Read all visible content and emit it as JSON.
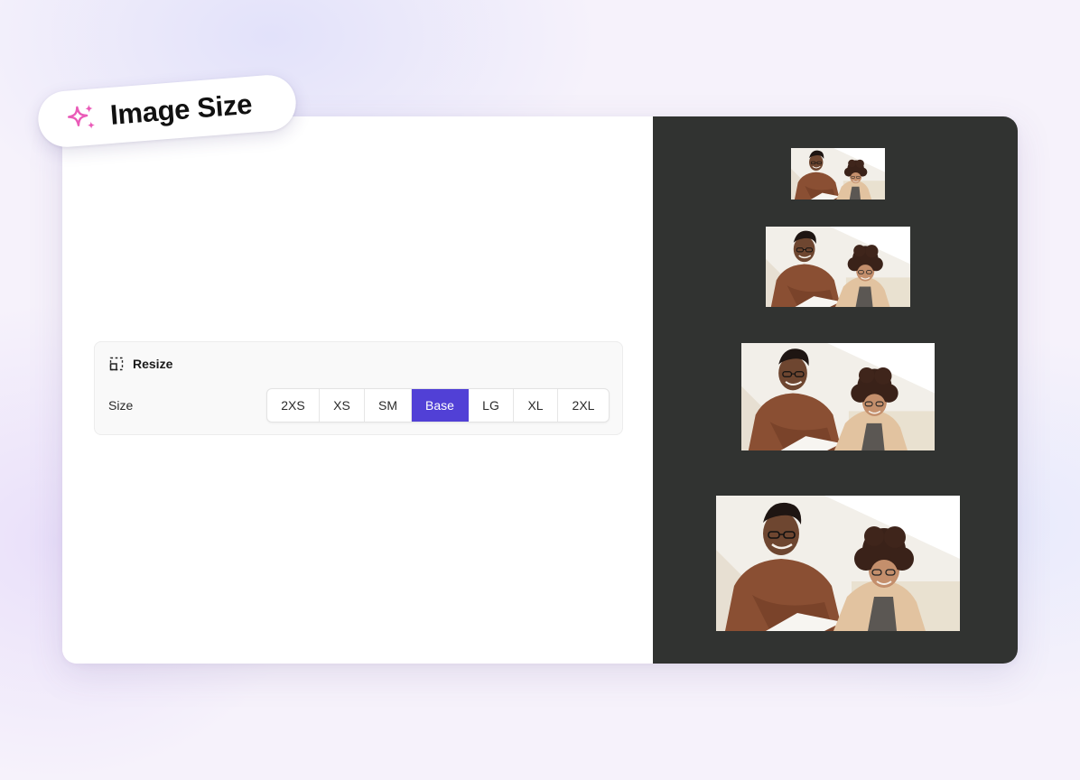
{
  "badge": {
    "icon": "sparkle-icon",
    "label": "Image Size",
    "icon_color": "#ea5bb8"
  },
  "resize_panel": {
    "icon": "resize-icon",
    "title": "Resize",
    "size_label": "Size",
    "sizes": [
      "2XS",
      "XS",
      "SM",
      "Base",
      "LG",
      "XL",
      "2XL"
    ],
    "selected": "Base",
    "accent_color": "#5140d6"
  },
  "preview": {
    "background": "#313331",
    "images": [
      "preview-image-xs",
      "preview-image-sm",
      "preview-image-base",
      "preview-image-lg"
    ]
  }
}
